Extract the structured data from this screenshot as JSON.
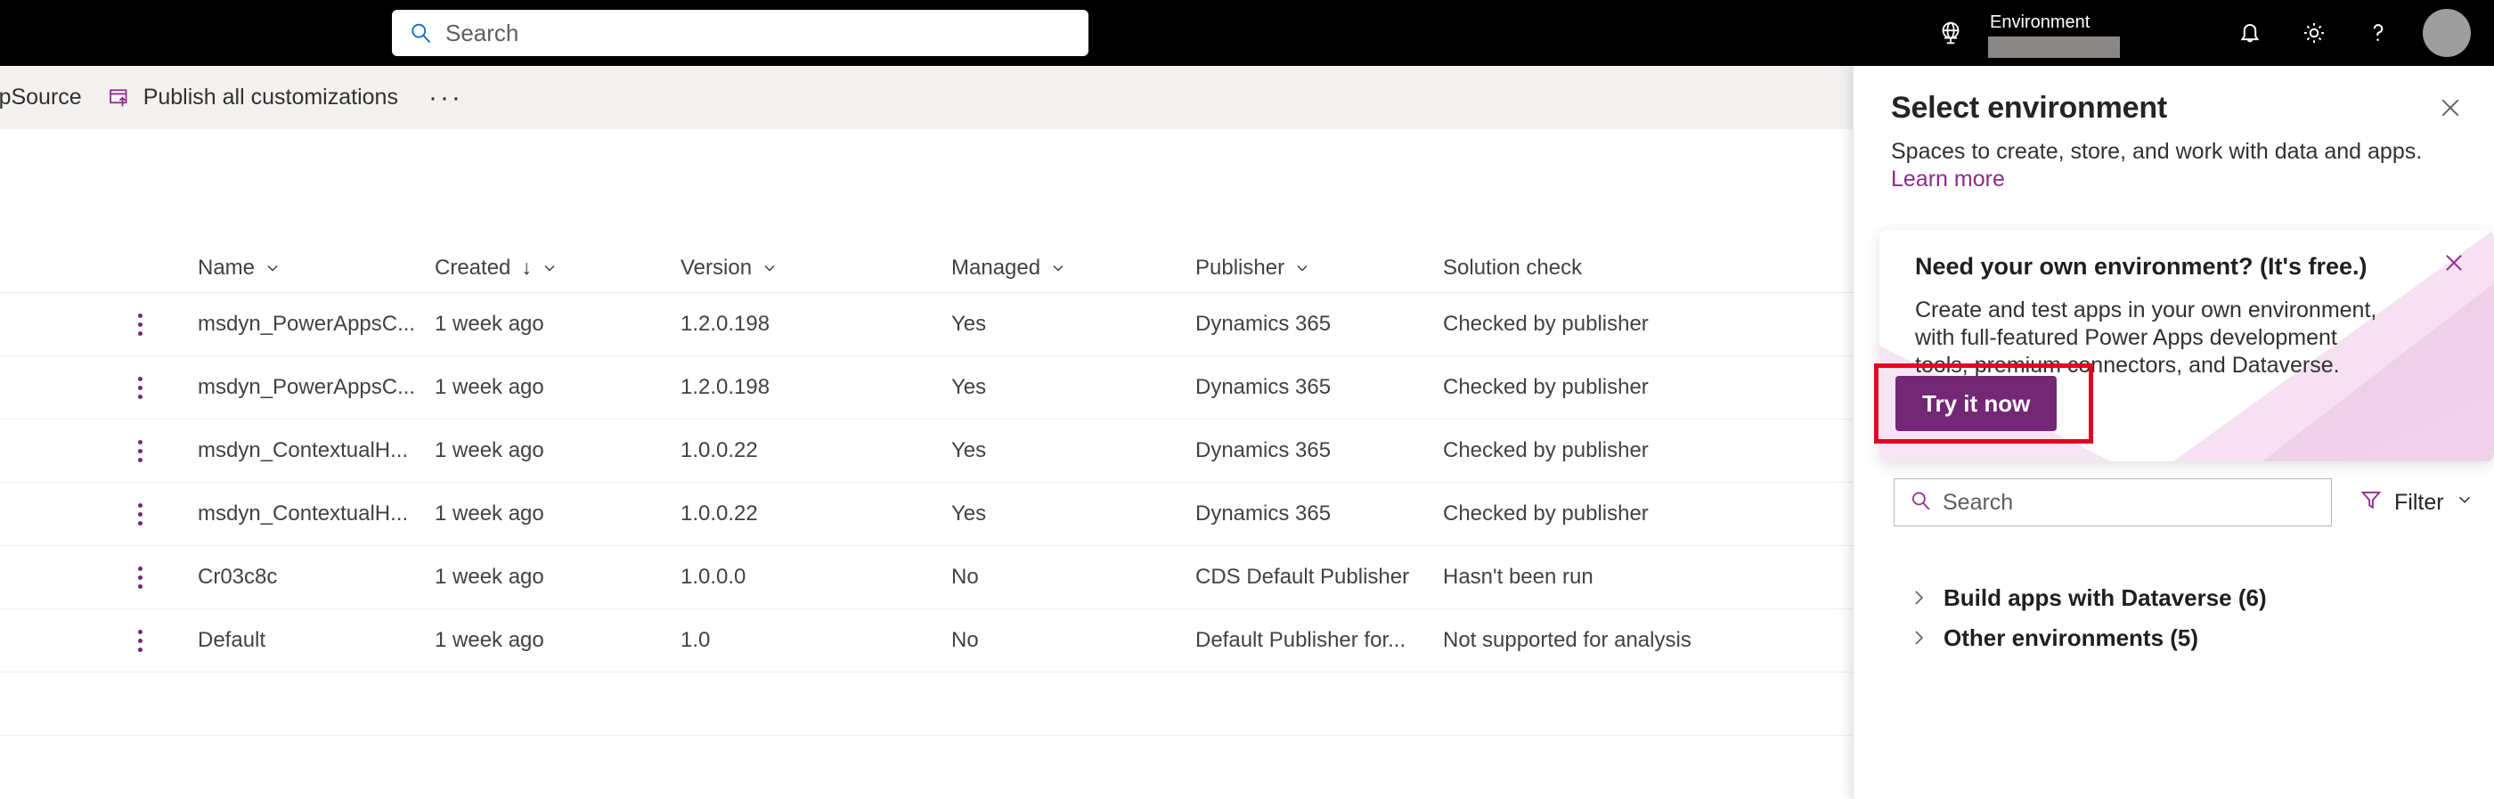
{
  "header": {
    "search": {
      "placeholder": "Search",
      "icon": "search-icon"
    },
    "globe_icon": "globe-icon",
    "environment_label": "Environment",
    "notifications_icon": "bell-icon",
    "settings_icon": "gear-icon",
    "help_icon": "question-mark-icon",
    "avatar": "user-avatar"
  },
  "command_bar": {
    "items": [
      {
        "label": "AppSource",
        "icon": null
      },
      {
        "label": "Publish all customizations",
        "icon": "publish-icon"
      }
    ],
    "overflow_label": "···"
  },
  "table": {
    "columns": [
      {
        "label": "Name",
        "sortable": true,
        "sorted": null
      },
      {
        "label": "Created",
        "sortable": true,
        "sorted": "desc"
      },
      {
        "label": "Version",
        "sortable": true,
        "sorted": null
      },
      {
        "label": "Managed",
        "sortable": true,
        "sorted": null
      },
      {
        "label": "Publisher",
        "sortable": true,
        "sorted": null
      },
      {
        "label": "Solution check",
        "sortable": false,
        "sorted": null
      }
    ],
    "rows": [
      {
        "name": "msdyn_PowerAppsC...",
        "created": "1 week ago",
        "version": "1.2.0.198",
        "managed": "Yes",
        "publisher": "Dynamics 365",
        "solution_check": "Checked by publisher"
      },
      {
        "name": "msdyn_PowerAppsC...",
        "created": "1 week ago",
        "version": "1.2.0.198",
        "managed": "Yes",
        "publisher": "Dynamics 365",
        "solution_check": "Checked by publisher"
      },
      {
        "name": "msdyn_ContextualH...",
        "created": "1 week ago",
        "version": "1.0.0.22",
        "managed": "Yes",
        "publisher": "Dynamics 365",
        "solution_check": "Checked by publisher"
      },
      {
        "name": "msdyn_ContextualH...",
        "created": "1 week ago",
        "version": "1.0.0.22",
        "managed": "Yes",
        "publisher": "Dynamics 365",
        "solution_check": "Checked by publisher"
      },
      {
        "name": "Cr03c8c",
        "created": "1 week ago",
        "version": "1.0.0.0",
        "managed": "No",
        "publisher": "CDS Default Publisher",
        "solution_check": "Hasn't been run"
      },
      {
        "name": "Default",
        "created": "1 week ago",
        "version": "1.0",
        "managed": "No",
        "publisher": "Default Publisher for...",
        "solution_check": "Not supported for analysis"
      }
    ]
  },
  "panel": {
    "title": "Select environment",
    "subtitle": "Spaces to create, store, and work with data and apps.",
    "link": "Learn more",
    "close_icon": "close-icon",
    "search": {
      "placeholder": "Search",
      "icon": "search-icon"
    },
    "filter": {
      "label": "Filter",
      "icon": "filter-icon"
    },
    "groups": [
      {
        "label": "Build apps with Dataverse (6)",
        "expanded": false
      },
      {
        "label": "Other environments (5)",
        "expanded": false
      }
    ]
  },
  "callout": {
    "title": "Need your own environment? (It's free.)",
    "body": "Create and test apps in your own environment, with full-featured Power Apps development tools, premium connectors, and Dataverse.",
    "button_label": "Try it now",
    "close_icon": "close-icon"
  },
  "annotation": {
    "highlight_color": "#e60023"
  },
  "colors": {
    "header_bg": "#000000",
    "command_bar_bg": "#f3f2f1",
    "brand_purple": "#742774",
    "link_purple": "#8c2a8c",
    "header_search_icon": "#0f6cbd",
    "highlight_red": "#e60023"
  }
}
